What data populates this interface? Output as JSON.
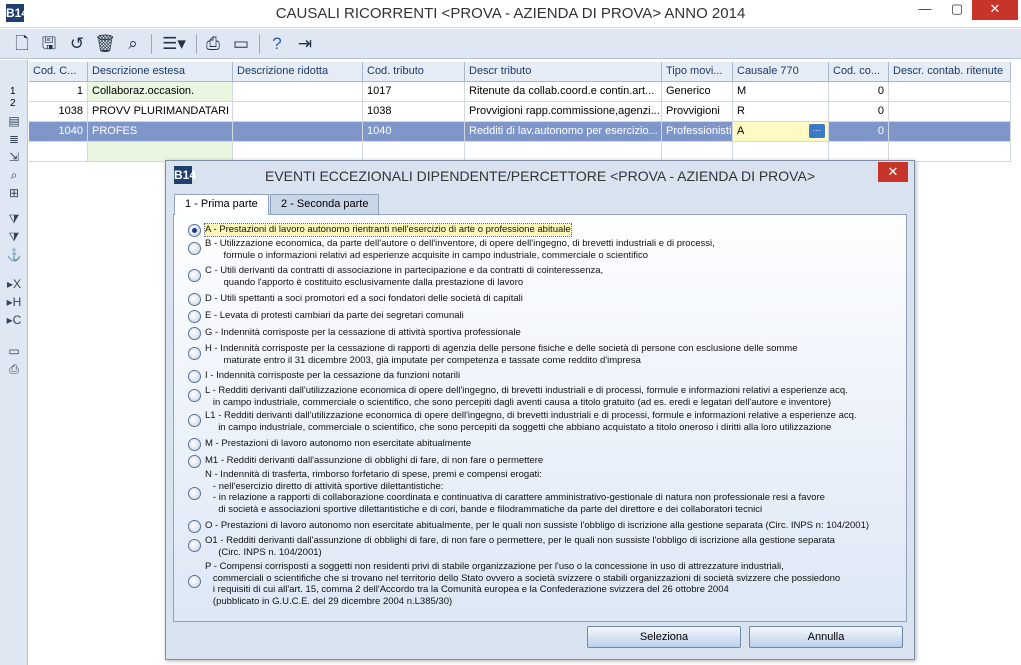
{
  "window": {
    "title": "CAUSALI RICORRENTI <PROVA - AZIENDA DI PROVA> ANNO 2014",
    "min": "—",
    "max": "▢",
    "close": "✕"
  },
  "app_icon": "B14",
  "toolbar_icons": [
    "new-icon",
    "save-icon",
    "undo-icon",
    "delete-icon",
    "find-icon",
    "columns-icon",
    "print-icon",
    "preview-icon",
    "help-icon",
    "exit-icon"
  ],
  "grid": {
    "headers": [
      "Cod. C...",
      "Descrizione estesa",
      "Descrizione ridotta",
      "Cod. tributo",
      "Descr tributo",
      "Tipo movi...",
      "Causale 770",
      "Cod. co...",
      "Descr. contab. ritenute"
    ],
    "row_numbers": [
      "1",
      "2"
    ],
    "rows": [
      [
        "1",
        "Collaboraz.occasion.",
        "",
        "1017",
        "Ritenute da collab.coord.e contin.art...",
        "Generico",
        "M",
        "0",
        ""
      ],
      [
        "1038",
        "PROVV PLURIMANDATARI",
        "",
        "1038",
        "Provvigioni rapp.commissione,agenzi...",
        "Provvigioni",
        "R",
        "0",
        ""
      ],
      [
        "1040",
        "PROFES",
        "",
        "1040",
        "Redditi di lav.autonomo per esercizio...",
        "Professionisti",
        "A",
        "0",
        ""
      ]
    ],
    "ellipsis": "···"
  },
  "dialog": {
    "title": "EVENTI ECCEZIONALI DIPENDENTE/PERCETTORE <PROVA - AZIENDA DI PROVA>",
    "close": "✕",
    "tabs": [
      "1 - Prima parte",
      "2 - Seconda parte"
    ],
    "options": [
      "A - Prestazioni di lavoro autonomo rientranti nell'esercizio di arte o professione abituale",
      "B - Utilizzazione economica, da parte dell'autore o dell'inventore, di opere dell'ingegno, di brevetti industriali e di processi,\n       formule o informazioni relativi ad esperienze acquisite in campo industriale, commerciale o scientifico",
      "C - Utili derivanti da contratti di associazione in partecipazione e da contratti di cointeressenza,\n       quando l'apporto è costituito esclusivamente dalla prestazione di lavoro",
      "D - Utili spettanti a soci promotori ed a soci fondatori delle società di capitali",
      "E - Levata di protesti cambiari da parte dei segretari comunali",
      "G - Indennità corrisposte per la cessazione di attività sportiva professionale",
      "H - Indennità corrisposte per la cessazione di rapporti di agenzia delle persone fisiche e delle società di persone con esclusione delle somme\n       maturate entro il 31 dicembre 2003, già imputate per competenza e tassate come reddito d'impresa",
      "I - Indennità corrisposte per la cessazione da funzioni notarili",
      "L - Redditi derivanti dall'utilizzazione economica di opere dell'ingegno, di brevetti industriali e di processi, formule e informazioni relativi a esperienze acq.\n   in campo industriale, commerciale o scientifico, che sono percepiti dagli aventi causa a titolo gratuito (ad es. eredi e legatari dell'autore e inventore)",
      "L1 - Redditi derivanti dall'utilizzazione economica di opere dell'ingegno, di brevetti industriali e di processi, formule e informazioni relative a esperienze acq.\n     in campo industriale, commerciale o scientifico, che sono percepiti da soggetti che abbiano acquistato a titolo oneroso i diritti alla loro utilizzazione",
      "M - Prestazioni di lavoro autonomo non esercitate abitualmente",
      "M1 - Redditi derivanti dall'assunzione di obblighi di fare, di non fare o permettere",
      "N - Indennità di trasferta, rimborso forfetario di spese, premi e compensi erogati:\n   - nell'esercizio diretto di attività sportive dilettantistiche:\n   - in relazione a rapporti di collaborazione coordinata e continuativa di carattere amministrativo-gestionale di natura non professionale resi a favore\n     di società e associazioni sportive dilettantistiche e di cori, bande e filodrammatiche da parte del direttore e dei collaboratori tecnici",
      "O - Prestazioni di lavoro autonomo non esercitate abitualmente, per le quali non sussiste l'obbligo di iscrizione alla gestione separata (Circ. INPS n: 104/2001)",
      "O1 - Redditi derivanti dall'assunzione di obblighi di fare, di non fare o permettere, per le quali non sussiste l'obbligo di iscrizione alla gestione separata\n     (Circ. INPS n. 104/2001)",
      "P - Compensi corrisposti a soggetti non residenti privi di stabile organizzazione per l'uso o la concessione in uso di attrezzature industriali,\n   commerciali o scientifiche che si trovano nel territorio dello Stato ovvero a società svizzere o stabili organizzazioni di società svizzere che possiedono\n   i requisiti di cui all'art. 15, comma 2 dell'Accordo tra la Comunità europea e la Confederazione svizzera del 26 ottobre 2004\n   (pubblicato in G.U.C.E. del 29 dicembre 2004 n.L385/30)"
    ],
    "selected_index": 0,
    "buttons": {
      "select": "Seleziona",
      "cancel": "Annulla"
    }
  }
}
